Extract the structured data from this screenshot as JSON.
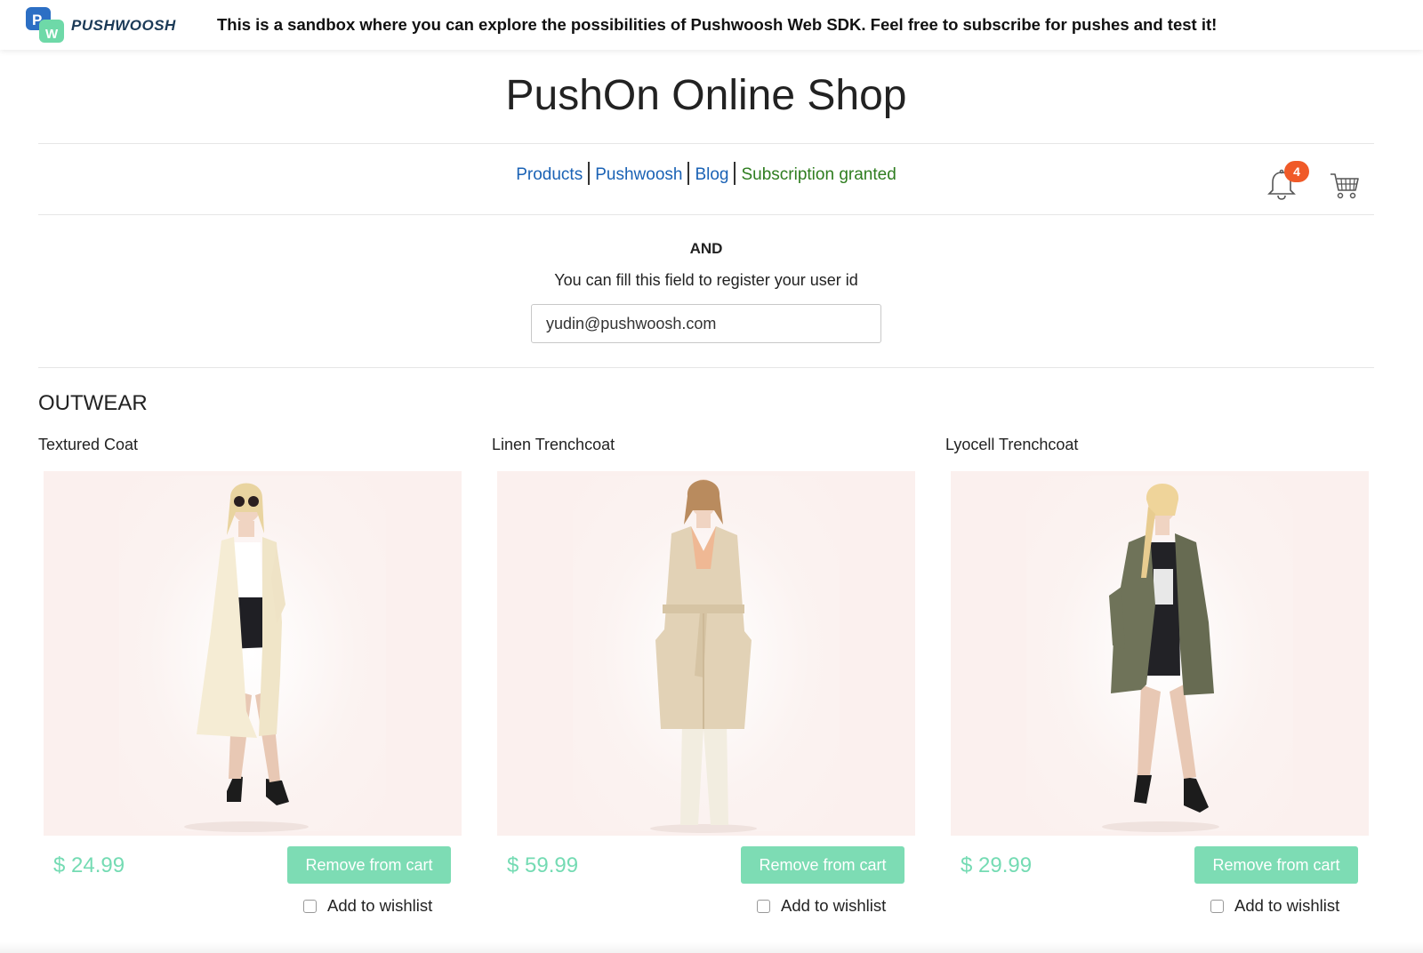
{
  "header": {
    "logo_text": "PUSHWOOSH",
    "logo_letters": [
      "P",
      "W"
    ],
    "banner": "This is a sandbox where you can explore the possibilities of Pushwoosh Web SDK. Feel free to subscribe for pushes and test it!"
  },
  "shop": {
    "title": "PushOn Online Shop"
  },
  "nav": {
    "items": [
      {
        "label": "Products"
      },
      {
        "label": "Pushwoosh"
      },
      {
        "label": "Blog"
      }
    ],
    "status": "Subscription granted",
    "notification_count": "4",
    "bell_icon": "bell-icon",
    "cart_icon": "shopping-cart-icon"
  },
  "register": {
    "and_label": "AND",
    "label": "You can fill this field to register your user id",
    "value": "yudin@pushwoosh.com"
  },
  "section": {
    "title": "OUTWEAR"
  },
  "products": [
    {
      "name": "Textured Coat",
      "price": "$ 24.99",
      "button": "Remove from cart",
      "wishlist": "Add to wishlist",
      "coat_color": "#f5ecd4"
    },
    {
      "name": "Linen Trenchcoat",
      "price": "$ 59.99",
      "button": "Remove from cart",
      "wishlist": "Add to wishlist",
      "coat_color": "#e2d2b6"
    },
    {
      "name": "Lyocell Trenchcoat",
      "price": "$ 29.99",
      "button": "Remove from cart",
      "wishlist": "Add to wishlist",
      "coat_color": "#6f7359"
    }
  ],
  "colors": {
    "accent": "#7ddcb4",
    "link": "#1a62b5",
    "status": "#2e7d1f",
    "badge": "#f05a28"
  }
}
